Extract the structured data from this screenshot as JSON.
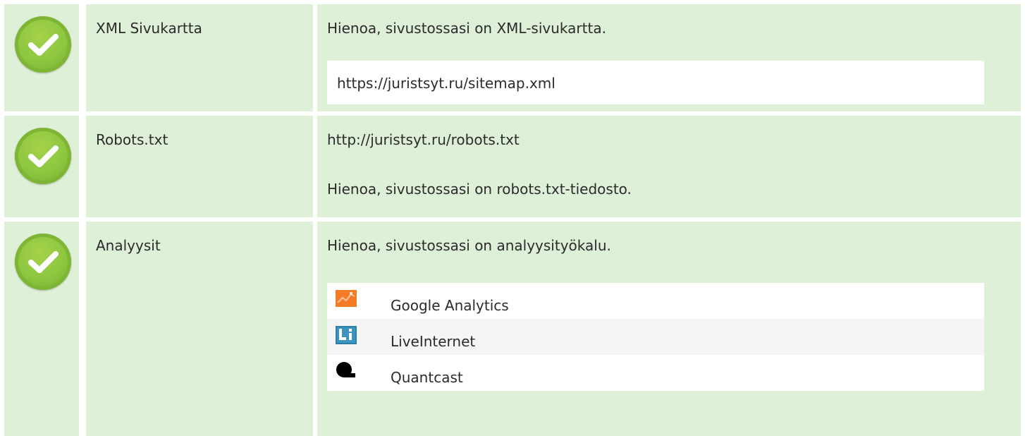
{
  "rows": [
    {
      "label": "XML Sivukartta",
      "message": "Hienoa, sivustossasi on XML-sivukartta.",
      "detail": "https://juristsyt.ru/sitemap.xml",
      "status_icon": "check-circle-icon"
    },
    {
      "label": "Robots.txt",
      "detail": "http://juristsyt.ru/robots.txt",
      "message": "Hienoa, sivustossasi on robots.txt-tiedosto.",
      "status_icon": "check-circle-icon"
    },
    {
      "label": "Analyysit",
      "message": "Hienoa, sivustossasi on analyysityökalu.",
      "status_icon": "check-circle-icon",
      "tools": [
        {
          "name": "Google Analytics",
          "icon": "google-analytics-icon"
        },
        {
          "name": "LiveInternet",
          "icon": "liveinternet-icon"
        },
        {
          "name": "Quantcast",
          "icon": "quantcast-icon"
        }
      ]
    }
  ],
  "colors": {
    "row_background": "#dff0d8",
    "check_green": "#8cc63f",
    "ga_orange": "#f57c26",
    "li_blue": "#2e7ea6",
    "quantcast_black": "#000000"
  }
}
